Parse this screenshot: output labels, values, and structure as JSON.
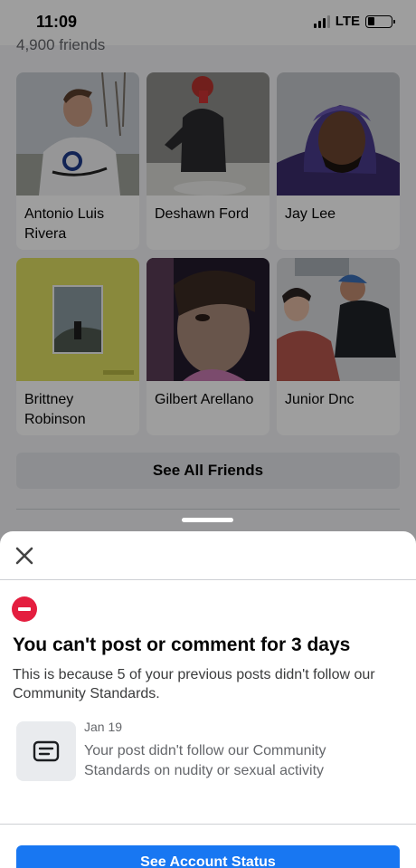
{
  "status_bar": {
    "time": "11:09",
    "network": "LTE"
  },
  "profile": {
    "friends_count": "4,900 friends",
    "friends": [
      {
        "name": "Antonio Luis Rivera"
      },
      {
        "name": "Deshawn Ford"
      },
      {
        "name": "Jay Lee"
      },
      {
        "name": "Brittney Robinson"
      },
      {
        "name": "Gilbert Arellano"
      },
      {
        "name": "Junior Dnc"
      }
    ],
    "see_all_label": "See All Friends"
  },
  "sheet": {
    "title": "You can't post or comment for 3 days",
    "description": "This is because 5 of your previous posts didn't follow our Community Standards.",
    "notice": {
      "date": "Jan 19",
      "text": "Your post didn't follow our Community Standards on nudity or sexual activity"
    },
    "button_label": "See Account Status"
  },
  "colors": {
    "accent": "#1877f2",
    "warning": "#e41e3f"
  },
  "icons": [
    "close-icon",
    "stop-icon",
    "notice-document-icon",
    "signal-icon",
    "battery-icon"
  ]
}
